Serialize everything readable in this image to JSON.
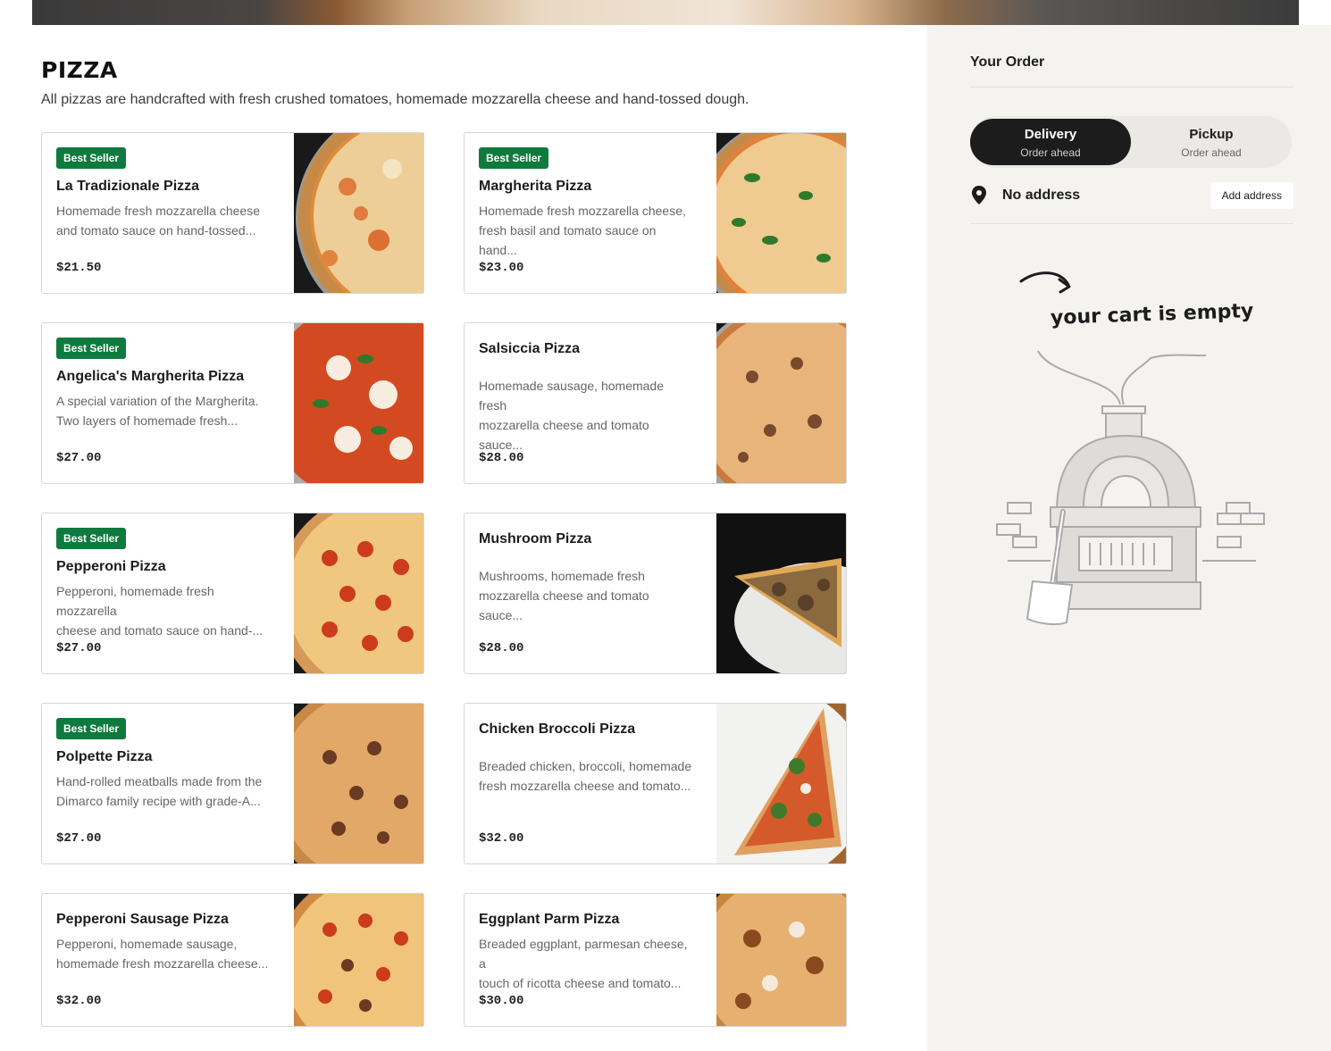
{
  "section": {
    "title": "PIZZA",
    "description": "All pizzas are handcrafted with fresh crushed tomatoes, homemade mozzarella cheese and hand-tossed dough."
  },
  "items": [
    {
      "name": "La Tradizionale Pizza",
      "badge": "Best Seller",
      "desc_1": "Homemade fresh mozzarella cheese",
      "desc_2": "and tomato sauce on hand-tossed...",
      "price": "$21.50"
    },
    {
      "name": "Margherita Pizza",
      "badge": "Best Seller",
      "desc_1": "Homemade fresh mozzarella cheese,",
      "desc_2": "fresh basil and tomato sauce on hand...",
      "price": "$23.00"
    },
    {
      "name": "Angelica's Margherita Pizza",
      "badge": "Best Seller",
      "desc_1": "A special variation of the Margherita.",
      "desc_2": "Two layers of homemade fresh...",
      "price": "$27.00"
    },
    {
      "name": "Salsiccia Pizza",
      "badge": "",
      "desc_1": "Homemade sausage, homemade fresh",
      "desc_2": "mozzarella cheese and tomato sauce...",
      "price": "$28.00"
    },
    {
      "name": "Pepperoni Pizza",
      "badge": "Best Seller",
      "desc_1": "Pepperoni, homemade fresh mozzarella",
      "desc_2": "cheese and tomato sauce on hand-...",
      "price": "$27.00"
    },
    {
      "name": "Mushroom Pizza",
      "badge": "",
      "desc_1": "Mushrooms, homemade fresh",
      "desc_2": "mozzarella cheese and tomato sauce...",
      "price": "$28.00"
    },
    {
      "name": "Polpette Pizza",
      "badge": "Best Seller",
      "desc_1": "Hand-rolled meatballs made from the",
      "desc_2": "Dimarco family recipe with grade-A...",
      "price": "$27.00"
    },
    {
      "name": "Chicken Broccoli Pizza",
      "badge": "",
      "desc_1": "Breaded chicken, broccoli, homemade",
      "desc_2": "fresh mozzarella cheese and tomato...",
      "price": "$32.00"
    },
    {
      "name": "Pepperoni Sausage Pizza",
      "badge": "",
      "desc_1": "Pepperoni, homemade sausage,",
      "desc_2": "homemade fresh mozzarella cheese...",
      "price": "$32.00"
    },
    {
      "name": "Eggplant Parm Pizza",
      "badge": "",
      "desc_1": "Breaded eggplant, parmesan cheese, a",
      "desc_2": "touch of ricotta cheese and tomato...",
      "price": "$30.00"
    }
  ],
  "order": {
    "title": "Your Order",
    "delivery_label": "Delivery",
    "delivery_sub": "Order ahead",
    "pickup_label": "Pickup",
    "pickup_sub": "Order ahead",
    "address_text": "No address",
    "add_address_label": "Add address",
    "empty_text": "your cart is empty"
  },
  "colors": {
    "badge": "#0f7a3e",
    "toggle_active": "#1c1c1c",
    "sidebar_bg": "#f4f3f0"
  },
  "icons": {
    "pin": "location-pin-icon",
    "arrow": "curved-arrow-icon",
    "oven": "pizza-oven-illustration"
  }
}
